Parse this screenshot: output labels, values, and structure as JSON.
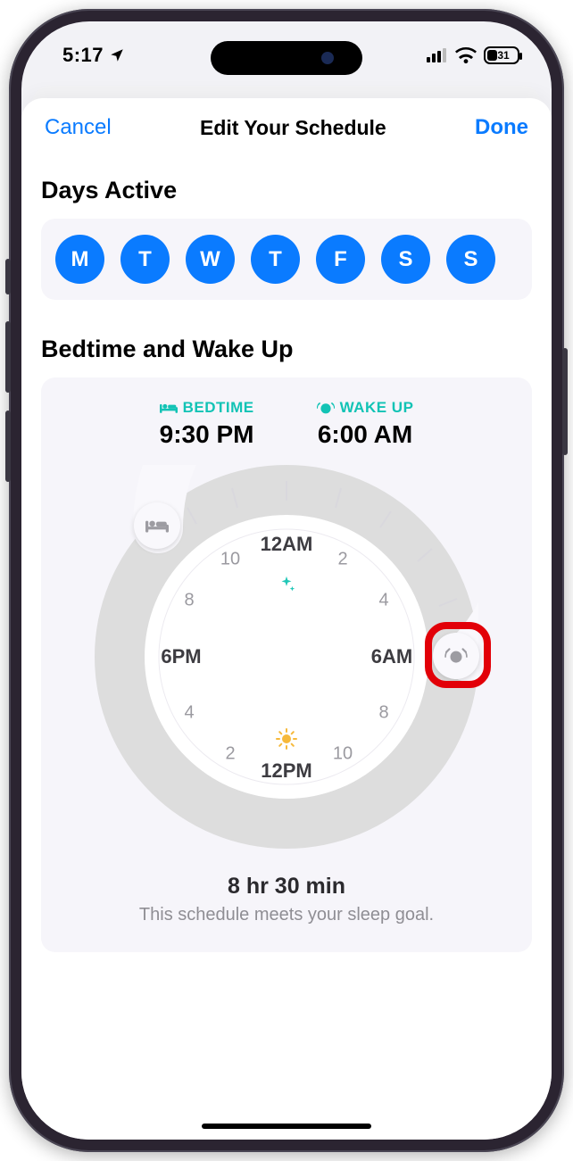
{
  "status": {
    "time": "5:17",
    "battery": "31"
  },
  "header": {
    "cancel": "Cancel",
    "title": "Edit Your Schedule",
    "done": "Done"
  },
  "days": {
    "title": "Days Active",
    "items": [
      "M",
      "T",
      "W",
      "T",
      "F",
      "S",
      "S"
    ]
  },
  "sleep": {
    "title": "Bedtime and Wake Up",
    "bedtime_label": "BEDTIME",
    "bedtime_value": "9:30 PM",
    "wake_label": "WAKE UP",
    "wake_value": "6:00 AM",
    "clock": {
      "top": "12AM",
      "bottom": "12PM",
      "left": "6PM",
      "right": "6AM",
      "h2": "2",
      "h4r": "4",
      "h8r": "8",
      "h10r": "10",
      "h10l": "10",
      "h8l": "8",
      "h4l": "4",
      "h2l": "2"
    },
    "duration": "8 hr 30 min",
    "goal_msg": "This schedule meets your sleep goal."
  },
  "colors": {
    "accent": "#0a7bff",
    "teal": "#12c3b5"
  }
}
